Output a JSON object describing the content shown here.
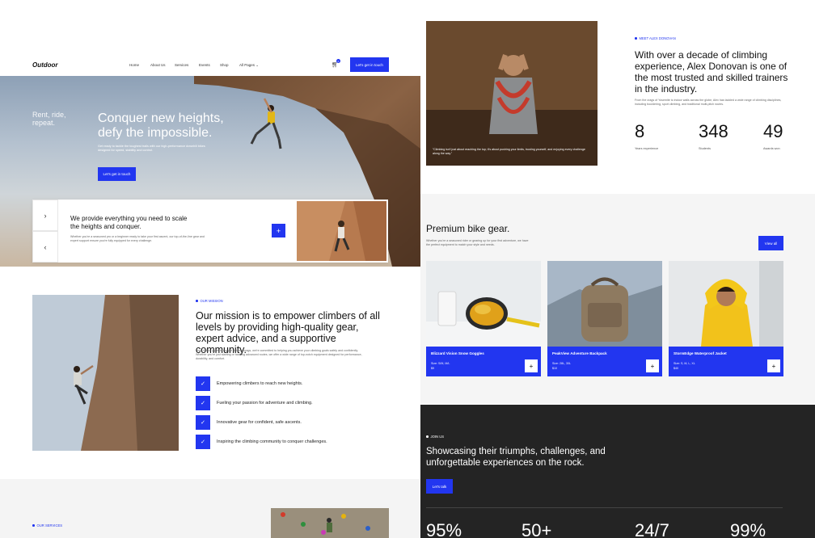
{
  "brand": {
    "logo": "Outdoor"
  },
  "nav": {
    "items": [
      "Home",
      "About Us",
      "Services",
      "Events",
      "Shop",
      "All Pages"
    ],
    "cart_count": "0",
    "cta": "Let's get in touch"
  },
  "hero": {
    "side_text": "Rent, ride, repeat.",
    "title": "Conquer new heights, defy the impossible.",
    "subtitle": "Get ready to tackle the toughest trails with our high-performance downhill bikes designed for speed, stability and control.",
    "cta": "Let's get in touch"
  },
  "provide": {
    "title": "We provide everything you need to scale the heights and conquer.",
    "text": "Whether you're a seasoned pro or a beginner ready to take your first ascent, our top-of-the-line gear and expert support ensure you're fully equipped for every challenge.",
    "prev_icon": "chevron-right-icon",
    "next_icon": "chevron-left-icon"
  },
  "mission": {
    "eyebrow": "OUR MISSION",
    "title": "Our mission is to empower climbers of all levels by providing high-quality gear, expert advice, and a supportive community.",
    "text": "From indoor gyms to rugged outdoor crags, we're committed to helping you achieve your climbing goals safely and confidently. Whether you're just starting or tackling advanced routes, we offer a wide range of top-notch equipment designed for performance, durability, and comfort.",
    "checks": [
      "Empowering climbers to reach new heights.",
      "Fueling your passion for adventure and climbing.",
      "Innovative gear for confident, safe ascents.",
      "Inspiring the climbing community to conquer challenges."
    ]
  },
  "services": {
    "eyebrow": "OUR SERVICES"
  },
  "trainer": {
    "quote": "\"Climbing isn't just about reaching the top; it's about pushing your limits, trusting yourself, and enjoying every challenge along the way.\"",
    "eyebrow": "MEET ALEX DONOVAN",
    "title": "With over a decade of climbing experience, Alex Donovan is one of the most trusted and skilled trainers in the industry.",
    "text": "From the crags of Yosemite to indoor walls across the globe, Alex has tackled a wide range of climbing disciplines, including bouldering, sport climbing, and traditional multi-pitch routes.",
    "stats": [
      {
        "value": "8",
        "label": "Years experience"
      },
      {
        "value": "348",
        "label": "Students"
      },
      {
        "value": "49",
        "label": "Awards won"
      }
    ]
  },
  "bike": {
    "title": "Premium bike gear.",
    "text": "Whether you're a seasoned rider or gearing up for your first adventure, we have the perfect equipment to match your style and needs.",
    "view_all": "View all",
    "products": [
      {
        "name": "Blizzard Vision Snow Goggles",
        "size": "Size: S/M, M/L",
        "price": "$9"
      },
      {
        "name": "PeakView Adventure Backpack",
        "size": "Size: 28L, 30L",
        "price": "$10"
      },
      {
        "name": "StormEdge Waterproof Jacket",
        "size": "Size: S, M, L, XL",
        "price": "$40"
      }
    ]
  },
  "join": {
    "eyebrow": "JOIN US",
    "title": "Showcasing their triumphs, challenges, and unforgettable experiences on the rock.",
    "cta": "Let's talk",
    "numbers": [
      "95%",
      "50+",
      "24/7",
      "99%"
    ]
  },
  "colors": {
    "accent": "#2236f0",
    "dark_band": "#242424",
    "light_band": "#f4f4f4"
  }
}
